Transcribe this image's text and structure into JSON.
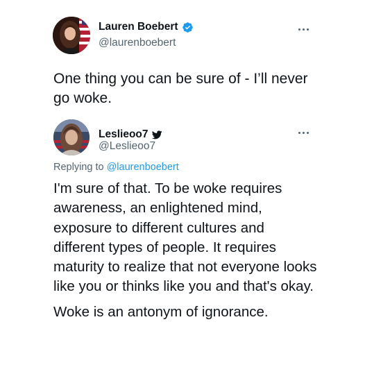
{
  "main_tweet": {
    "display_name": "Lauren Boebert",
    "handle": "@laurenboebert",
    "verified": true,
    "text": "One thing you can be sure of - I’ll never go woke."
  },
  "reply_tweet": {
    "display_name": "Leslieoo7",
    "handle": "@Leslieoo7",
    "replying_prefix": "Replying to ",
    "replying_handle": "@laurenboebert",
    "paragraphs": [
      "I'm sure of that. To be woke requires awareness, an enlightened mind, exposure to different cultures and different types of people. It requires maturity to realize that not everyone looks like you or thinks like you and that's okay.",
      "Woke is an antonym of ignorance."
    ]
  },
  "icons": {
    "verified": "verified-badge-icon",
    "twitter": "twitter-bird-icon",
    "more": "more-options-icon"
  },
  "colors": {
    "text_primary": "#0f1419",
    "text_secondary": "#536471",
    "link": "#1d9bf0",
    "verified": "#1d9bf0"
  }
}
